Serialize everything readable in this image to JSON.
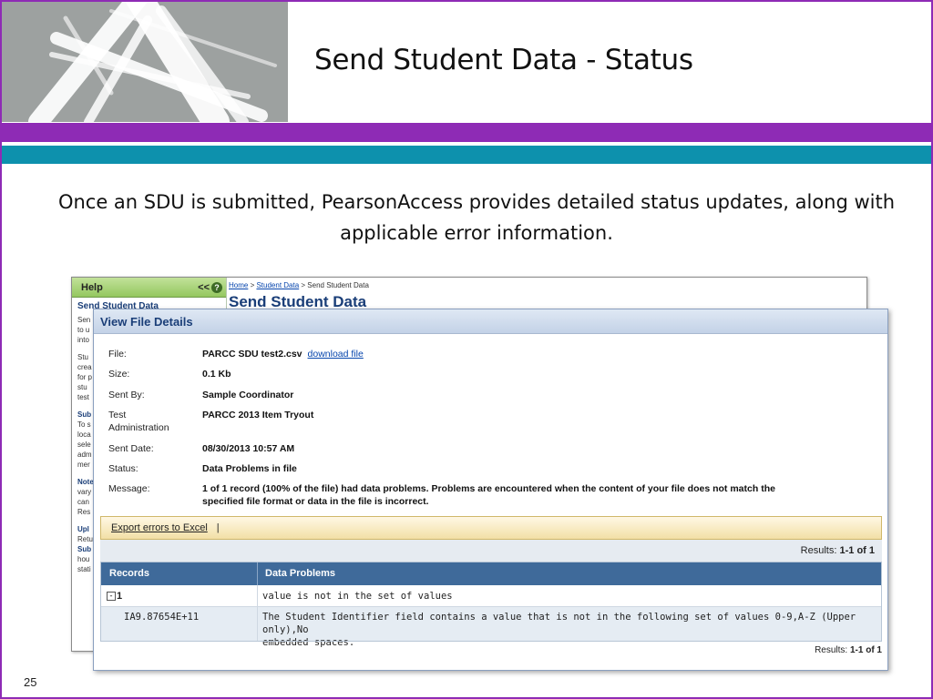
{
  "slide": {
    "title": "Send Student Data - Status",
    "intro": "Once an SDU is submitted, PearsonAccess provides detailed status updates, along with applicable error information.",
    "page_number": "25",
    "colors": {
      "purple_band": "#8e2bb5",
      "teal_band": "#0d91ad",
      "logo_bg": "#9da1a0"
    },
    "logo_icon": "stylized-a-logo-icon"
  },
  "background_app": {
    "breadcrumb": {
      "home": "Home",
      "sep1": " > ",
      "student_data": "Student Data",
      "sep2": " > ",
      "current": "Send Student Data"
    },
    "page_title": "Send Student Data",
    "help_panel": {
      "header": "Help",
      "collapse": "<<",
      "help_icon": "question-icon",
      "subtitle": "Send Student Data",
      "lines": [
        "Sen",
        "to u",
        "into",
        "",
        "Stu",
        "crea",
        "for p",
        "stu",
        "test",
        "",
        "Sub",
        "To s",
        "loca",
        "sele",
        "adm",
        "mer",
        "",
        "Note",
        "vary",
        "can",
        "Res",
        "",
        "Upl",
        "Retu",
        "Sub",
        "hou",
        "stati"
      ]
    }
  },
  "dialog": {
    "title": "View File Details",
    "fields": {
      "file_label": "File:",
      "file_value": "PARCC SDU test2.csv",
      "download_link": "download file",
      "size_label": "Size:",
      "size_value": "0.1 Kb",
      "sent_by_label": "Sent By:",
      "sent_by_value": "Sample Coordinator",
      "test_admin_label_1": "Test",
      "test_admin_label_2": "Administration",
      "test_admin_value": "PARCC 2013 Item Tryout",
      "sent_date_label": "Sent Date:",
      "sent_date_value": "08/30/2013 10:57 AM",
      "status_label": "Status:",
      "status_value": "Data Problems in file",
      "message_label": "Message:",
      "message_line_1": "1 of 1 record (100% of the file) had data problems. Problems are encountered when the content of your file does not match the",
      "message_line_2": "specified file format or data in the file is incorrect."
    },
    "export_link": "Export errors to Excel",
    "export_sep": "|",
    "results_label": "Results:",
    "results_value": "1-1 of 1",
    "table": {
      "headers": [
        "Records",
        "Data Problems"
      ],
      "group_row": {
        "expander": "-",
        "record": "1",
        "problem": "value is not in the set of values"
      },
      "detail_row": {
        "record": "IA9.87654E+11",
        "problem_line_1": "The Student Identifier field contains a value that is not in the following set of values 0-9,A-Z (Upper only),No",
        "problem_line_2": "embedded spaces."
      }
    },
    "footer_results_label": "Results:",
    "footer_results_value": "1-1 of 1"
  }
}
